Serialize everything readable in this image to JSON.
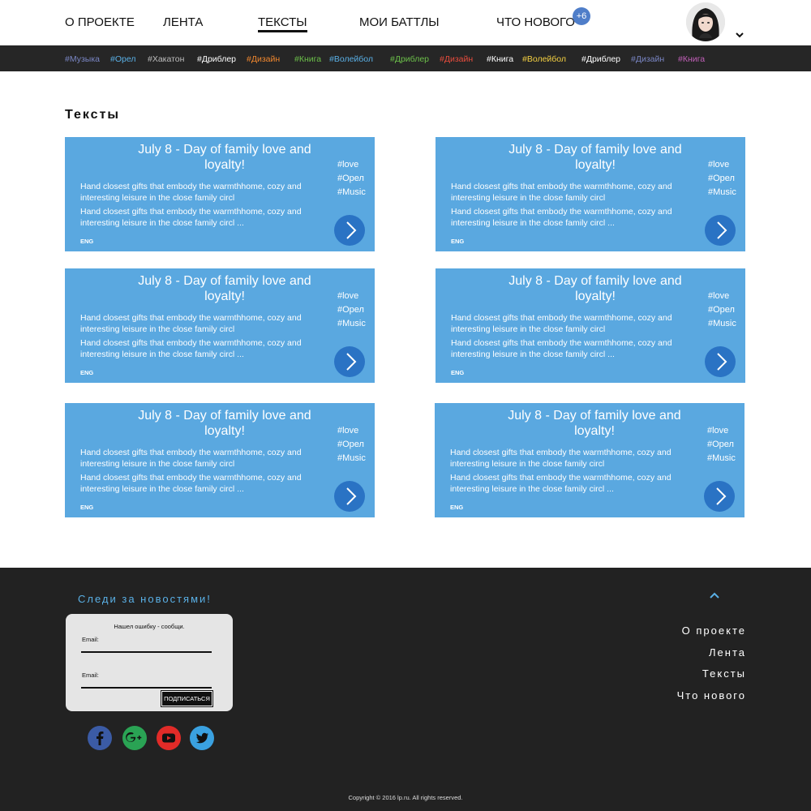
{
  "nav": {
    "items": [
      {
        "label": "О ПРОЕКТЕ",
        "active": false
      },
      {
        "label": "ЛЕНТА",
        "active": false
      },
      {
        "label": "ТЕКСТЫ",
        "active": true
      },
      {
        "label": "МОИ БАТТЛЫ",
        "active": false
      },
      {
        "label": "ЧТО НОВОГО",
        "active": false
      }
    ],
    "badge": "+6"
  },
  "tags": [
    {
      "label": "#Музыка",
      "color": "#7a86c4"
    },
    {
      "label": "#Орел",
      "color": "#5ab0e6"
    },
    {
      "label": "#Хакатон",
      "color": "#bdbdbd"
    },
    {
      "label": "#Дриблер",
      "color": "#ffffff"
    },
    {
      "label": "#Дизайн",
      "color": "#f0872e"
    },
    {
      "label": "#Книга",
      "color": "#6cc04a"
    },
    {
      "label": "#Волейбол",
      "color": "#5ab0e6"
    },
    {
      "label": "#Дриблер",
      "color": "#6cc04a"
    },
    {
      "label": "#Дизайн",
      "color": "#e84c3d"
    },
    {
      "label": "#Книга",
      "color": "#ffffff"
    },
    {
      "label": "#Волейбол",
      "color": "#f5d142"
    },
    {
      "label": "#Дриблер",
      "color": "#ffffff"
    },
    {
      "label": "#Дизайн",
      "color": "#7a86c4"
    },
    {
      "label": "#Книга",
      "color": "#c15fb8"
    }
  ],
  "main": {
    "title": "Тексты",
    "cards": [
      {
        "title": "July 8 - Day of family love and loyalty!",
        "tags": [
          "#love",
          "#Орел",
          "#Music"
        ],
        "p1": "Hand closest gifts that embody the warmthhome, cozy and interesting leisure in the close family circl",
        "p2": "Hand closest gifts that embody the warmthhome, cozy and interesting leisure in the close family circl ...",
        "lang": "ENG"
      },
      {
        "title": "July 8 - Day of family love and loyalty!",
        "tags": [
          "#love",
          "#Орел",
          "#Music"
        ],
        "p1": "Hand closest gifts that embody the warmthhome, cozy and interesting leisure in the close family circl",
        "p2": "Hand closest gifts that embody the warmthhome, cozy and interesting leisure in the close family circl ...",
        "lang": "ENG"
      },
      {
        "title": "July 8 - Day of family love and loyalty!",
        "tags": [
          "#love",
          "#Орел",
          "#Music"
        ],
        "p1": "Hand closest gifts that embody the warmthhome, cozy and interesting leisure in the close family circl",
        "p2": "Hand closest gifts that embody the warmthhome, cozy and interesting leisure in the close family circl ...",
        "lang": "ENG"
      },
      {
        "title": "July 8 - Day of family love and loyalty!",
        "tags": [
          "#love",
          "#Орел",
          "#Music"
        ],
        "p1": "Hand closest gifts that embody the warmthhome, cozy and interesting leisure in the close family circl",
        "p2": "Hand closest gifts that embody the warmthhome, cozy and interesting leisure in the close family circl ...",
        "lang": "ENG"
      },
      {
        "title": "July 8 - Day of family love and loyalty!",
        "tags": [
          "#love",
          "#Орел",
          "#Music"
        ],
        "p1": "Hand closest gifts that embody the warmthhome, cozy and interesting leisure in the close family circl",
        "p2": "Hand closest gifts that embody the warmthhome, cozy and interesting leisure in the close family circl ...",
        "lang": "ENG"
      },
      {
        "title": "July 8 - Day of family love and loyalty!",
        "tags": [
          "#love",
          "#Орел",
          "#Music"
        ],
        "p1": "Hand closest gifts that embody the warmthhome, cozy and interesting leisure in the close family circl",
        "p2": "Hand closest gifts that embody the warmthhome, cozy and interesting leisure in the close family circl ...",
        "lang": "ENG"
      }
    ]
  },
  "footer": {
    "follow_title": "Следи за новостями!",
    "form": {
      "caption": "Нашел ошибку - сообщи.",
      "email_label_1": "Email:",
      "email_label_2": "Email:",
      "subscribe_label": "ПОДПИСАТЬСЯ"
    },
    "social": [
      {
        "icon": "facebook-icon",
        "color": "#3b5ba5"
      },
      {
        "icon": "google-plus-icon",
        "color": "#2aa354"
      },
      {
        "icon": "youtube-icon",
        "color": "#e12b28"
      },
      {
        "icon": "twitter-icon",
        "color": "#3aa1e0"
      }
    ],
    "links": [
      "О проекте",
      "Лента",
      "Тексты",
      "Что нового"
    ],
    "copyright": "Copyright © 2016 lp.ru. All rights reserved."
  },
  "colors": {
    "card_bg": "#5aa8e0",
    "arrow_bg": "#2a73c4",
    "tagbar_bg": "#262626",
    "footer_bg": "#222222",
    "accent": "#5ab0e6"
  }
}
